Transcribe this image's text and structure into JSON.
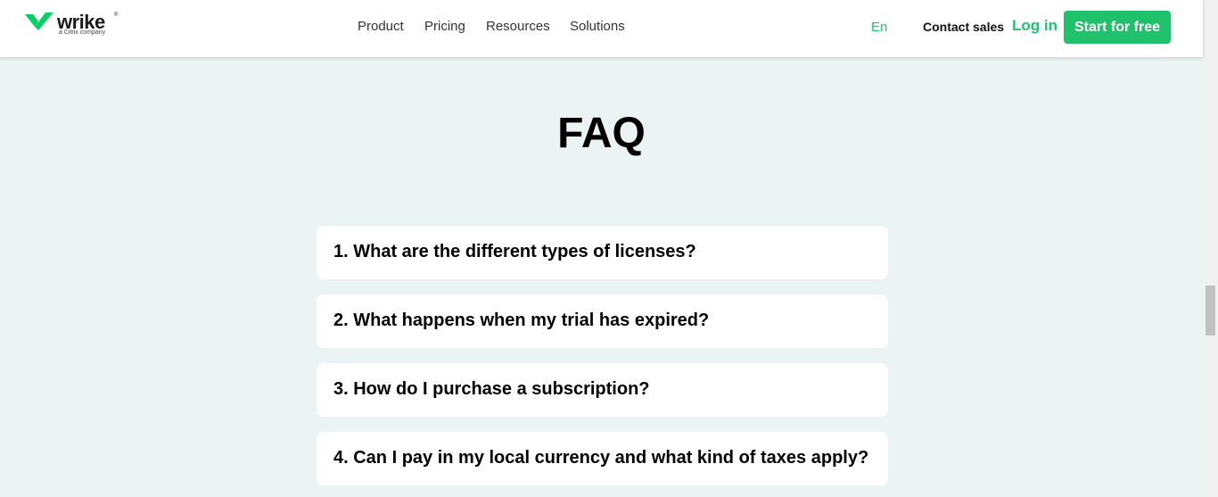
{
  "header": {
    "logo": {
      "word": "wrike",
      "trademark": "®",
      "subtitle": "a Citrix company",
      "icon": "checkmark-logo-icon"
    },
    "nav": [
      "Product",
      "Pricing",
      "Resources",
      "Solutions"
    ],
    "language": "En",
    "contact_sales": "Contact sales",
    "login": "Log in",
    "start_button": "Start for free"
  },
  "main": {
    "title": "FAQ",
    "questions": [
      "1. What are the different types of licenses?",
      "2. What happens when my trial has expired?",
      "3. How do I purchase a subscription?",
      "4. Can I pay in my local currency and what kind of taxes apply?"
    ]
  },
  "colors": {
    "brand_green": "#1fc16b",
    "page_background": "#ebf4f2"
  }
}
